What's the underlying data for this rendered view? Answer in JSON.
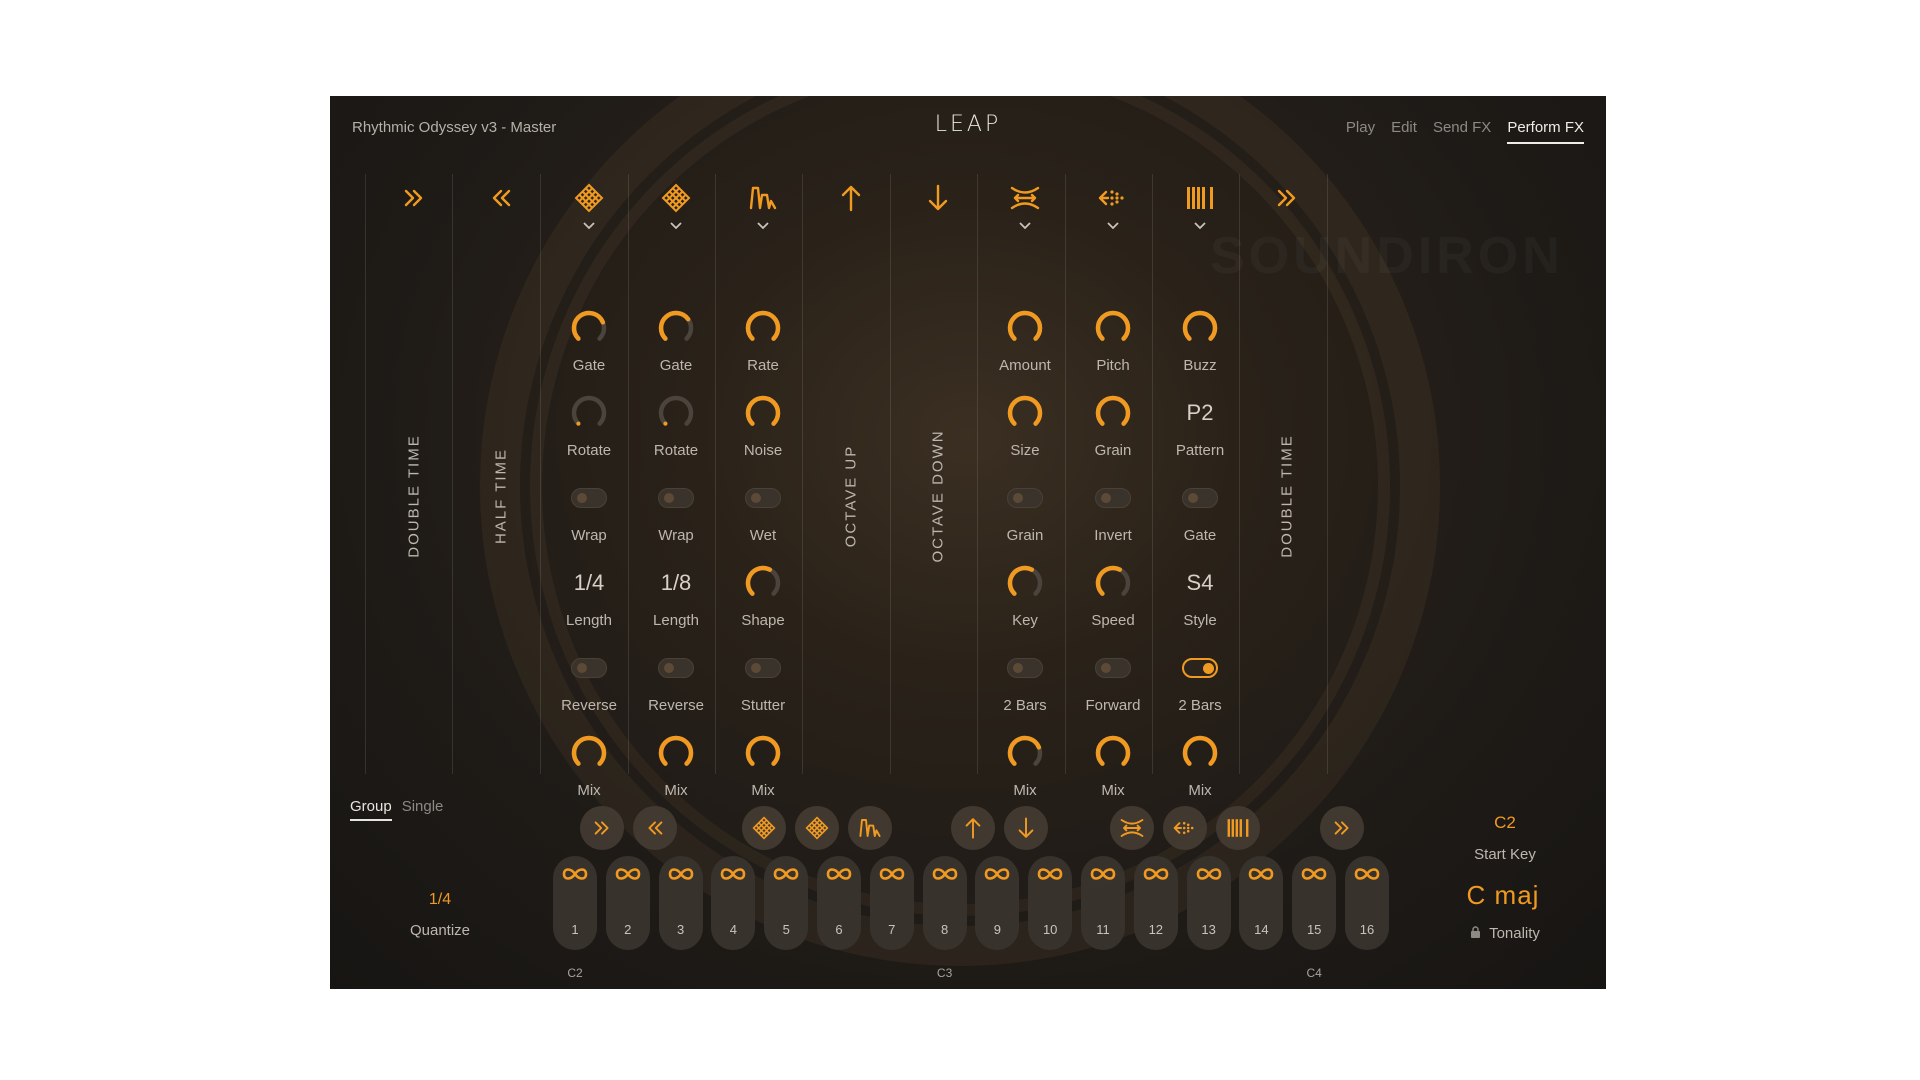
{
  "header": {
    "preset_name": "Rhythmic Odyssey v3 - Master",
    "logo": "LEAP",
    "tabs": [
      {
        "label": "Play",
        "active": false
      },
      {
        "label": "Edit",
        "active": false
      },
      {
        "label": "Send FX",
        "active": false
      },
      {
        "label": "Perform FX",
        "active": true
      }
    ]
  },
  "watermark": "SOUNDIRON",
  "accent_color": "#f19a22",
  "columns": [
    {
      "id": "double-time-left",
      "icon": "double-chevron-right-icon",
      "vertical_label": "DOUBLE TIME"
    },
    {
      "id": "half-time",
      "icon": "double-chevron-left-icon",
      "vertical_label": "HALF TIME"
    },
    {
      "id": "stutter-a",
      "icon": "diamond-grid-icon",
      "has_dropdown": true,
      "controls": [
        {
          "type": "knob",
          "label": "Gate",
          "value": 0.75
        },
        {
          "type": "knob",
          "label": "Rotate",
          "value": 0.0
        },
        {
          "type": "toggle",
          "label": "Wrap",
          "on": false
        },
        {
          "type": "value",
          "label": "Length",
          "value": "1/4"
        },
        {
          "type": "toggle",
          "label": "Reverse",
          "on": false
        },
        {
          "type": "knob",
          "label": "Mix",
          "value": 1.0
        }
      ]
    },
    {
      "id": "stutter-b",
      "icon": "diamond-grid-icon",
      "has_dropdown": true,
      "controls": [
        {
          "type": "knob",
          "label": "Gate",
          "value": 0.7
        },
        {
          "type": "knob",
          "label": "Rotate",
          "value": 0.0
        },
        {
          "type": "toggle",
          "label": "Wrap",
          "on": false
        },
        {
          "type": "value",
          "label": "Length",
          "value": "1/8"
        },
        {
          "type": "toggle",
          "label": "Reverse",
          "on": false
        },
        {
          "type": "knob",
          "label": "Mix",
          "value": 1.0
        }
      ]
    },
    {
      "id": "modulator",
      "icon": "wave-shape-icon",
      "has_dropdown": true,
      "controls": [
        {
          "type": "knob",
          "label": "Rate",
          "value": 1.0
        },
        {
          "type": "knob",
          "label": "Noise",
          "value": 1.0
        },
        {
          "type": "toggle",
          "label": "Wet",
          "on": false
        },
        {
          "type": "knob",
          "label": "Shape",
          "value": 0.6
        },
        {
          "type": "toggle",
          "label": "Stutter",
          "on": false
        },
        {
          "type": "knob",
          "label": "Mix",
          "value": 1.0
        }
      ]
    },
    {
      "id": "octave-up",
      "icon": "arrow-up-icon",
      "vertical_label": "OCTAVE UP"
    },
    {
      "id": "octave-down",
      "icon": "arrow-down-icon",
      "vertical_label": "OCTAVE DOWN"
    },
    {
      "id": "granular",
      "icon": "stretch-icon",
      "has_dropdown": true,
      "controls": [
        {
          "type": "knob",
          "label": "Amount",
          "value": 1.0
        },
        {
          "type": "knob",
          "label": "Size",
          "value": 1.0
        },
        {
          "type": "toggle",
          "label": "Grain",
          "on": false
        },
        {
          "type": "knob",
          "label": "Key",
          "value": 0.6
        },
        {
          "type": "toggle",
          "label": "2 Bars",
          "on": false
        },
        {
          "type": "knob",
          "label": "Mix",
          "value": 0.75
        }
      ]
    },
    {
      "id": "scatter",
      "icon": "dotted-arrows-icon",
      "has_dropdown": true,
      "controls": [
        {
          "type": "knob",
          "label": "Pitch",
          "value": 1.0
        },
        {
          "type": "knob",
          "label": "Grain",
          "value": 1.0
        },
        {
          "type": "toggle",
          "label": "Invert",
          "on": false
        },
        {
          "type": "knob",
          "label": "Speed",
          "value": 0.6
        },
        {
          "type": "toggle",
          "label": "Forward",
          "on": false
        },
        {
          "type": "knob",
          "label": "Mix",
          "value": 1.0
        }
      ]
    },
    {
      "id": "buzz",
      "icon": "bars-icon",
      "has_dropdown": true,
      "controls": [
        {
          "type": "knob",
          "label": "Buzz",
          "value": 1.0
        },
        {
          "type": "value",
          "label": "Pattern",
          "value": "P2"
        },
        {
          "type": "toggle",
          "label": "Gate",
          "on": false
        },
        {
          "type": "value",
          "label": "Style",
          "value": "S4"
        },
        {
          "type": "toggle",
          "label": "2 Bars",
          "on": true
        },
        {
          "type": "knob",
          "label": "Mix",
          "value": 1.0
        }
      ]
    },
    {
      "id": "double-time-right",
      "icon": "double-chevron-right-icon",
      "vertical_label": "DOUBLE TIME"
    }
  ],
  "bottom": {
    "mode_tabs": [
      {
        "label": "Group",
        "active": true
      },
      {
        "label": "Single",
        "active": false
      }
    ],
    "quantize": {
      "value": "1/4",
      "label": "Quantize"
    },
    "fx_buttons": [
      "double-chevron-right-icon",
      "double-chevron-left-icon",
      "diamond-grid-icon",
      "diamond-grid-icon",
      "wave-shape-icon",
      "arrow-up-icon",
      "arrow-down-icon",
      "stretch-icon",
      "dotted-arrows-icon",
      "bars-icon",
      "double-chevron-right-icon"
    ],
    "pads": [
      "1",
      "2",
      "3",
      "4",
      "5",
      "6",
      "7",
      "8",
      "9",
      "10",
      "11",
      "12",
      "13",
      "14",
      "15",
      "16"
    ],
    "note_labels": [
      {
        "pad": 1,
        "text": "C2"
      },
      {
        "pad": 8,
        "text": "C3"
      },
      {
        "pad": 15,
        "text": "C4"
      }
    ],
    "start_key": {
      "value": "C2",
      "label": "Start Key"
    },
    "tonality": {
      "value": "C  maj",
      "label": "Tonality"
    }
  }
}
